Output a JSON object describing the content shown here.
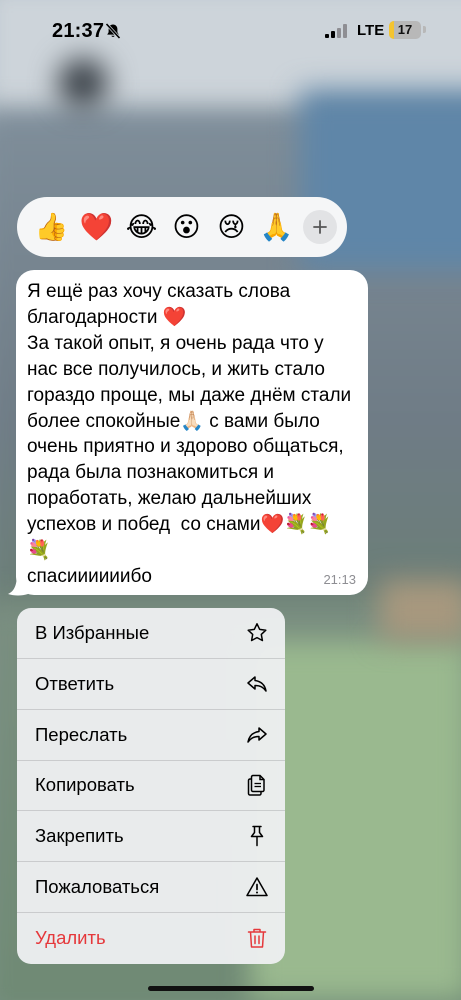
{
  "status_bar": {
    "time": "21:37",
    "network": "LTE",
    "battery_level": "17",
    "battery_fraction": 0.17,
    "battery_color": "#f4c430"
  },
  "reactions": {
    "items": [
      {
        "emoji": "👍",
        "icon": "thumbs-up"
      },
      {
        "emoji": "❤️",
        "icon": "red-heart"
      },
      {
        "emoji": "😂",
        "icon": "tears-of-joy"
      },
      {
        "emoji": "😮",
        "icon": "surprised"
      },
      {
        "emoji": "😢",
        "icon": "crying"
      },
      {
        "emoji": "🙏",
        "icon": "folded-hands"
      }
    ],
    "more_icon": "plus-icon"
  },
  "message": {
    "text": "Я ещё раз хочу сказать слова благодарности ❤️\nЗа такой опыт, я очень рада что у нас все получилось, и жить стало гораздо проще, мы даже днём стали более спокойные🙏🏻 с вами было очень приятно и здорово общаться, рада была познакомиться и поработать, желаю дальнейших успехов и побед  со снами❤️💐💐💐\nспасиииииибо",
    "time": "21:13"
  },
  "context_menu": {
    "items": [
      {
        "label": "В Избранные",
        "icon": "star-icon"
      },
      {
        "label": "Ответить",
        "icon": "reply-icon"
      },
      {
        "label": "Переслать",
        "icon": "forward-icon"
      },
      {
        "label": "Копировать",
        "icon": "copy-icon"
      },
      {
        "label": "Закрепить",
        "icon": "pin-icon"
      },
      {
        "label": "Пожаловаться",
        "icon": "warning-icon"
      },
      {
        "label": "Удалить",
        "icon": "trash-icon",
        "destructive": true,
        "color": "#e5383b"
      }
    ]
  }
}
